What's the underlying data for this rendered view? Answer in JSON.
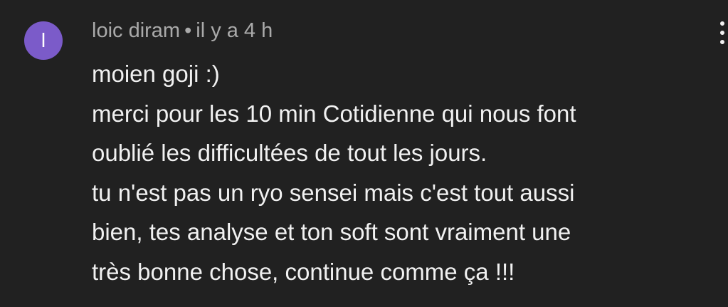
{
  "comment": {
    "avatar_letter": "l",
    "author": "loic diram",
    "separator": "•",
    "time": "il y a 4 h",
    "lines": [
      "moien goji :)",
      "merci pour les 10 min Cotidienne qui nous font",
      "oublié les difficultées de tout les jours.",
      "tu n'est pas un ryo sensei mais c'est tout aussi",
      "bien, tes analyse et ton soft sont vraiment une",
      "très bonne chose, continue comme ça !!!"
    ],
    "menu_icon": "more-vert-icon"
  },
  "colors": {
    "background": "#212121",
    "avatar": "#7b5bc9",
    "meta_text": "#aaaaaa",
    "body_text": "#f1f1f1"
  }
}
